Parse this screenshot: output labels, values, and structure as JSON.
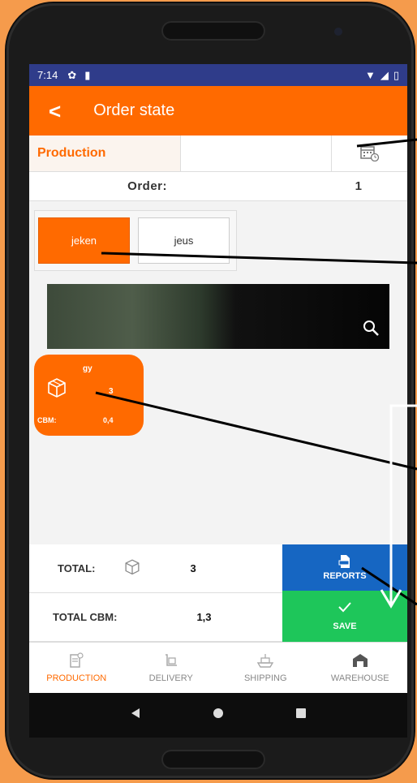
{
  "status": {
    "time": "7:14"
  },
  "appbar": {
    "title": "Order state"
  },
  "production": {
    "label": "Production",
    "field_value": ""
  },
  "order": {
    "label": "Order:",
    "value": "1"
  },
  "tabs": [
    {
      "label": "jeken"
    },
    {
      "label": "jeus"
    }
  ],
  "card": {
    "name": "gy",
    "qty": "3",
    "cbm_label": "CBM:",
    "cbm_value": "0,4"
  },
  "totals": {
    "total_label": "TOTAL:",
    "total_value": "3",
    "cbm_label": "TOTAL CBM:",
    "cbm_value": "1,3"
  },
  "actions": {
    "reports": "REPORTS",
    "save": "SAVE"
  },
  "nav": {
    "items": [
      {
        "label": "PRODUCTION"
      },
      {
        "label": "DELIVERY"
      },
      {
        "label": "SHIPPING"
      },
      {
        "label": "WAREHOUSE"
      }
    ]
  },
  "colors": {
    "accent": "#ff6a00",
    "reports": "#1666c2",
    "save": "#1ec65a",
    "statusbar": "#2f3c8a",
    "background": "#f59b4c"
  }
}
